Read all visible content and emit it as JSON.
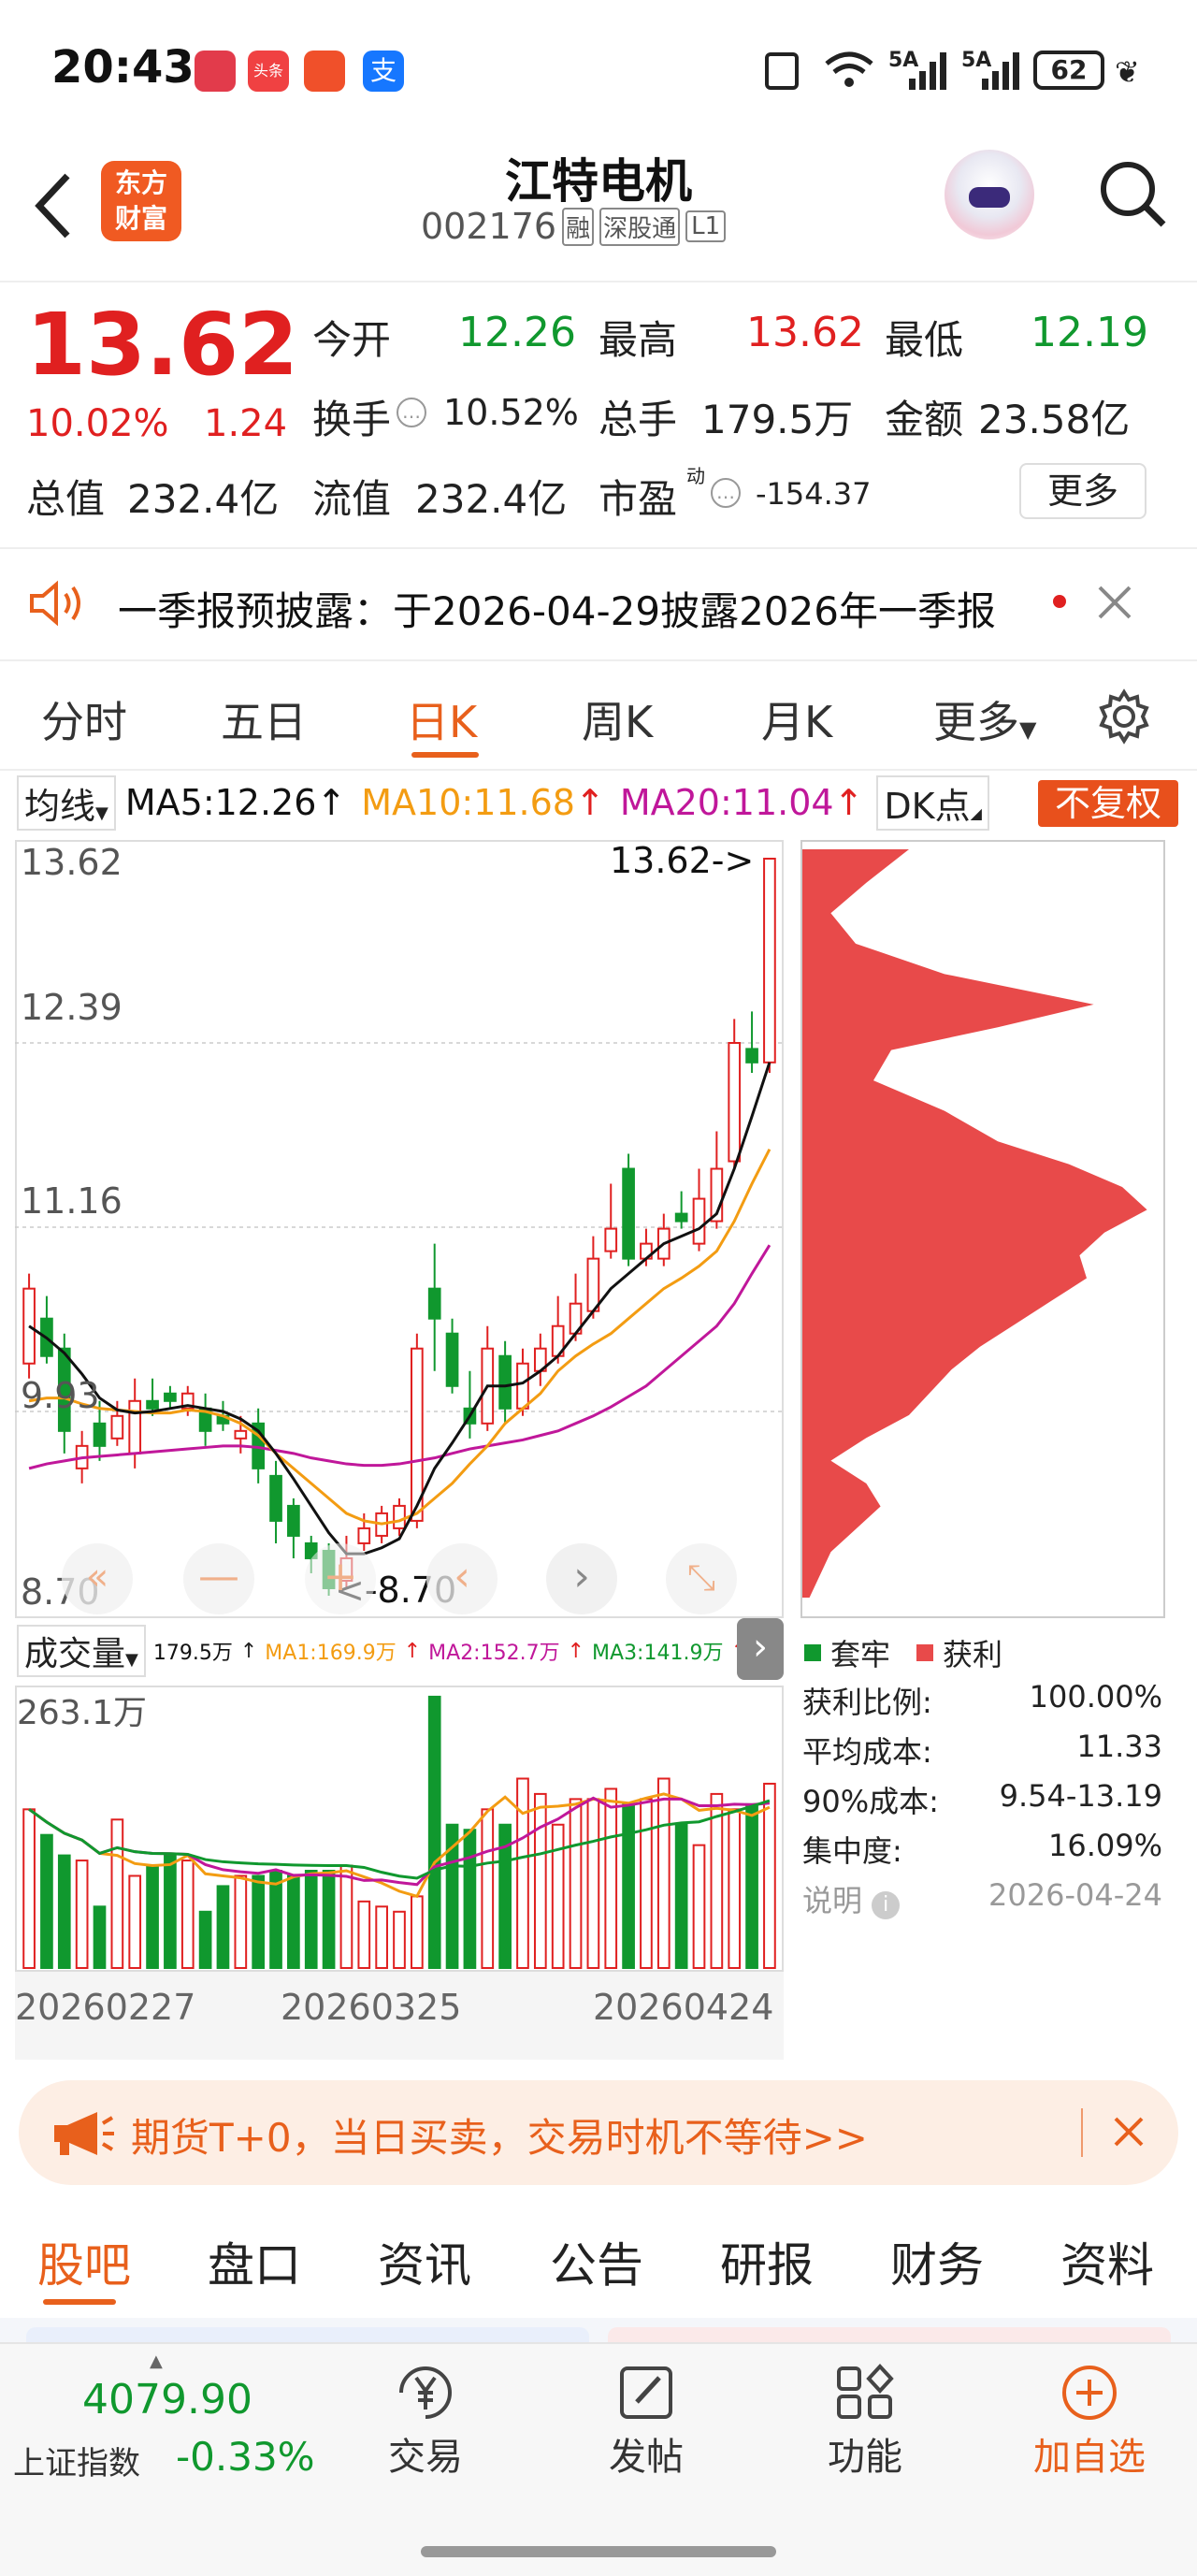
{
  "status_bar": {
    "time": "20:43",
    "network": "5A",
    "battery": "62"
  },
  "header": {
    "title": "江特电机",
    "code": "002176",
    "badges": [
      "融",
      "深股通",
      "L1"
    ],
    "logo_text": [
      "东方",
      "财富"
    ]
  },
  "quote": {
    "price": "13.62",
    "change_pct": "10.02%",
    "change": "1.24",
    "open_label": "今开",
    "open": "12.26",
    "high_label": "最高",
    "high": "13.62",
    "low_label": "最低",
    "low": "12.19",
    "turnover_label": "换手",
    "turnover": "10.52%",
    "volume_label": "总手",
    "volume": "179.5万",
    "amount_label": "金额",
    "amount": "23.58亿",
    "mcap_label": "总值",
    "mcap": "232.4亿",
    "float_label": "流值",
    "float_cap": "232.4亿",
    "pe_label": "市盈",
    "pe_sup": "动",
    "pe": "-154.37",
    "more_btn": "更多"
  },
  "notice": {
    "text": "一季报预披露：于2026-04-29披露2026年一季报"
  },
  "period_tabs": [
    "分时",
    "五日",
    "日K",
    "周K",
    "月K",
    "更多"
  ],
  "active_period": 2,
  "ma_bar": {
    "selector": "均线",
    "ma5": "MA5:12.26",
    "ma10": "MA10:11.68",
    "ma20": "MA20:11.04",
    "dk": "DK点",
    "fq": "不复权"
  },
  "kline_labels": {
    "y_top": "13.62",
    "y_mid1": "12.39",
    "y_mid2": "11.16",
    "y_mid3": "9.93",
    "y_bot": "8.70",
    "max_note": "13.62->",
    "min_note": "<-8.70"
  },
  "volume_bar": {
    "selector": "成交量",
    "vol": "179.5万",
    "ma1": "MA1:169.9万",
    "ma2": "MA2:152.7万",
    "ma3": "MA3:141.9万",
    "y_top": "263.1万"
  },
  "x_dates": [
    "20260227",
    "20260325",
    "20260424"
  ],
  "chips": {
    "legend_trap": "套牢",
    "legend_profit": "获利",
    "rows": [
      {
        "label": "获利比例:",
        "value": "100.00%"
      },
      {
        "label": "平均成本:",
        "value": "11.33"
      },
      {
        "label": "90%成本:",
        "value": "9.54-13.19"
      },
      {
        "label": "集中度:",
        "value": "16.09%"
      }
    ],
    "note_label": "说明",
    "note_date": "2026-04-24"
  },
  "ad_banner": {
    "text": "期货T+0，当日买卖，交易时机不等待>>"
  },
  "section_tabs": [
    "股吧",
    "盘口",
    "资讯",
    "公告",
    "研报",
    "财务",
    "资料"
  ],
  "bottom_nav": {
    "index_value": "4079.90",
    "index_name": "上证指数",
    "index_change": "-0.33%",
    "items": [
      "交易",
      "发帖",
      "功能",
      "加自选"
    ]
  },
  "colors": {
    "up": "#e02020",
    "down": "#10982e",
    "ma5": "#111111",
    "ma10": "#f39c12",
    "ma20": "#c0179a",
    "accent": "#e8601c"
  },
  "chart_data": {
    "type": "candlestick",
    "y_range": [
      8.7,
      13.62
    ],
    "candles": [
      {
        "o": 10.25,
        "c": 10.75,
        "h": 10.85,
        "l": 10.15
      },
      {
        "o": 10.55,
        "c": 10.3,
        "h": 10.7,
        "l": 10.25
      },
      {
        "o": 10.35,
        "c": 9.8,
        "h": 10.45,
        "l": 9.65
      },
      {
        "o": 9.55,
        "c": 9.7,
        "h": 9.8,
        "l": 9.45
      },
      {
        "o": 9.85,
        "c": 9.7,
        "h": 10.0,
        "l": 9.6
      },
      {
        "o": 9.75,
        "c": 9.9,
        "h": 10.0,
        "l": 9.7
      },
      {
        "o": 9.65,
        "c": 10.0,
        "h": 10.15,
        "l": 9.55
      },
      {
        "o": 10.0,
        "c": 9.95,
        "h": 10.15,
        "l": 9.9
      },
      {
        "o": 10.05,
        "c": 10.0,
        "h": 10.1,
        "l": 9.95
      },
      {
        "o": 9.95,
        "c": 10.05,
        "h": 10.1,
        "l": 9.9
      },
      {
        "o": 9.95,
        "c": 9.8,
        "h": 10.05,
        "l": 9.7
      },
      {
        "o": 9.9,
        "c": 9.85,
        "h": 10.0,
        "l": 9.8
      },
      {
        "o": 9.75,
        "c": 9.8,
        "h": 9.9,
        "l": 9.65
      },
      {
        "o": 9.85,
        "c": 9.55,
        "h": 9.95,
        "l": 9.45
      },
      {
        "o": 9.5,
        "c": 9.2,
        "h": 9.6,
        "l": 9.05
      },
      {
        "o": 9.3,
        "c": 9.1,
        "h": 9.35,
        "l": 8.95
      },
      {
        "o": 9.05,
        "c": 8.95,
        "h": 9.1,
        "l": 8.85
      },
      {
        "o": 9.0,
        "c": 8.75,
        "h": 9.05,
        "l": 8.7
      },
      {
        "o": 8.8,
        "c": 8.95,
        "h": 9.1,
        "l": 8.75
      },
      {
        "o": 9.05,
        "c": 9.15,
        "h": 9.25,
        "l": 9.0
      },
      {
        "o": 9.1,
        "c": 9.25,
        "h": 9.3,
        "l": 9.05
      },
      {
        "o": 9.15,
        "c": 9.3,
        "h": 9.35,
        "l": 9.1
      },
      {
        "o": 9.2,
        "c": 10.35,
        "h": 10.45,
        "l": 9.15
      },
      {
        "o": 10.75,
        "c": 10.55,
        "h": 11.05,
        "l": 10.2
      },
      {
        "o": 10.45,
        "c": 10.1,
        "h": 10.55,
        "l": 10.05
      },
      {
        "o": 9.95,
        "c": 9.85,
        "h": 10.2,
        "l": 9.75
      },
      {
        "o": 9.85,
        "c": 10.35,
        "h": 10.5,
        "l": 9.8
      },
      {
        "o": 10.3,
        "c": 9.95,
        "h": 10.4,
        "l": 9.85
      },
      {
        "o": 9.95,
        "c": 10.25,
        "h": 10.35,
        "l": 9.9
      },
      {
        "o": 10.2,
        "c": 10.35,
        "h": 10.45,
        "l": 10.1
      },
      {
        "o": 10.3,
        "c": 10.5,
        "h": 10.7,
        "l": 10.25
      },
      {
        "o": 10.45,
        "c": 10.65,
        "h": 10.85,
        "l": 10.4
      },
      {
        "o": 10.6,
        "c": 10.95,
        "h": 11.1,
        "l": 10.55
      },
      {
        "o": 11.0,
        "c": 11.15,
        "h": 11.45,
        "l": 10.95
      },
      {
        "o": 11.55,
        "c": 10.95,
        "h": 11.65,
        "l": 10.9
      },
      {
        "o": 10.95,
        "c": 11.05,
        "h": 11.15,
        "l": 10.9
      },
      {
        "o": 10.95,
        "c": 11.15,
        "h": 11.25,
        "l": 10.9
      },
      {
        "o": 11.25,
        "c": 11.2,
        "h": 11.4,
        "l": 11.15
      },
      {
        "o": 11.05,
        "c": 11.35,
        "h": 11.55,
        "l": 11.0
      },
      {
        "o": 11.2,
        "c": 11.55,
        "h": 11.8,
        "l": 11.15
      },
      {
        "o": 11.6,
        "c": 12.39,
        "h": 12.55,
        "l": 11.55
      },
      {
        "o": 12.35,
        "c": 12.26,
        "h": 12.6,
        "l": 12.19
      },
      {
        "o": 12.26,
        "c": 13.62,
        "h": 13.62,
        "l": 12.19
      }
    ],
    "ma5": [
      10.5,
      10.42,
      10.32,
      10.18,
      10.02,
      9.94,
      9.92,
      9.93,
      9.95,
      9.97,
      9.95,
      9.93,
      9.88,
      9.8,
      9.65,
      9.48,
      9.3,
      9.12,
      8.98,
      8.98,
      9.02,
      9.08,
      9.3,
      9.55,
      9.72,
      9.9,
      10.1,
      10.1,
      10.12,
      10.2,
      10.3,
      10.45,
      10.6,
      10.75,
      10.85,
      10.95,
      11.05,
      11.1,
      11.15,
      11.25,
      11.55,
      11.9,
      12.26
    ],
    "ma10": [
      10.0,
      10.02,
      10.02,
      9.98,
      9.95,
      9.94,
      9.93,
      9.92,
      9.92,
      9.94,
      9.93,
      9.9,
      9.85,
      9.77,
      9.65,
      9.55,
      9.45,
      9.35,
      9.25,
      9.2,
      9.18,
      9.2,
      9.25,
      9.35,
      9.45,
      9.58,
      9.7,
      9.85,
      9.95,
      10.05,
      10.2,
      10.3,
      10.38,
      10.45,
      10.55,
      10.65,
      10.75,
      10.82,
      10.9,
      11.0,
      11.2,
      11.45,
      11.68
    ],
    "ma20": [
      9.55,
      9.58,
      9.6,
      9.62,
      9.63,
      9.64,
      9.65,
      9.66,
      9.67,
      9.68,
      9.69,
      9.7,
      9.7,
      9.69,
      9.67,
      9.65,
      9.62,
      9.6,
      9.58,
      9.57,
      9.57,
      9.58,
      9.6,
      9.62,
      9.65,
      9.68,
      9.7,
      9.72,
      9.74,
      9.77,
      9.8,
      9.85,
      9.9,
      9.96,
      10.03,
      10.1,
      10.2,
      10.3,
      10.4,
      10.5,
      10.65,
      10.85,
      11.04
    ],
    "volume_range": [
      0,
      263.1
    ],
    "volumes": [
      155,
      130,
      110,
      105,
      60,
      145,
      90,
      100,
      110,
      105,
      55,
      80,
      90,
      90,
      95,
      90,
      95,
      95,
      100,
      65,
      60,
      55,
      70,
      265,
      140,
      135,
      155,
      140,
      185,
      170,
      140,
      165,
      165,
      175,
      160,
      165,
      185,
      140,
      120,
      170,
      155,
      160,
      180
    ],
    "chips_profit_pct": 100
  }
}
